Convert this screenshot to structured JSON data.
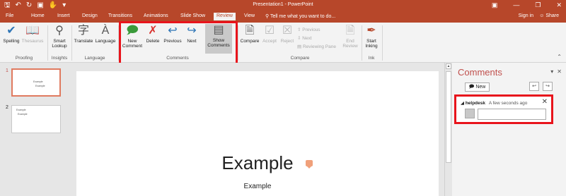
{
  "title_bar": {
    "title": "Presentation1 - PowerPoint",
    "qat_icons": [
      "save-icon",
      "undo-icon",
      "redo-icon",
      "start-slideshow-icon",
      "touch-mode-icon",
      "customize-qat-icon"
    ],
    "window_controls": [
      "ribbon-display-icon",
      "minimize-icon",
      "restore-icon",
      "close-icon"
    ]
  },
  "tabs": {
    "items": [
      "File",
      "Home",
      "Insert",
      "Design",
      "Transitions",
      "Animations",
      "Slide Show",
      "Review",
      "View"
    ],
    "active": "Review",
    "tell_me": "Tell me what you want to do...",
    "sign_in": "Sign in",
    "share": "Share"
  },
  "ribbon": {
    "proofing": {
      "spelling": "Spelling",
      "thesaurus": "Thesaurus",
      "label": "Proofing"
    },
    "insights": {
      "smart_lookup_1": "Smart",
      "smart_lookup_2": "Lookup",
      "label": "Insights"
    },
    "language": {
      "translate": "Translate",
      "language": "Language",
      "label": "Language"
    },
    "comments": {
      "new_comment_1": "New",
      "new_comment_2": "Comment",
      "delete": "Delete",
      "previous": "Previous",
      "next": "Next",
      "show_comments_1": "Show",
      "show_comments_2": "Comments",
      "label": "Comments"
    },
    "compare": {
      "compare": "Compare",
      "accept": "Accept",
      "reject": "Reject",
      "previous": "Previous",
      "next": "Next",
      "reviewing_pane": "Reviewing Pane",
      "end_review_1": "End",
      "end_review_2": "Review",
      "label": "Compare"
    },
    "ink": {
      "start_inking_1": "Start",
      "start_inking_2": "Inking",
      "label": "Ink"
    }
  },
  "thumbnails": [
    {
      "number": "1",
      "title": "Example",
      "subtitle": "Example",
      "selected": true
    },
    {
      "number": "2",
      "title": "Example",
      "subtitle": "Example",
      "selected": false
    }
  ],
  "slide": {
    "title": "Example",
    "subtitle": "Example"
  },
  "comments_pane": {
    "title": "Comments",
    "new_button": "New",
    "comment": {
      "author": "helpdesk",
      "time": "A few seconds ago"
    }
  },
  "colors": {
    "accent": "#b7472a",
    "highlight": "#e8141c",
    "comment_marker": "#f0a07a"
  }
}
